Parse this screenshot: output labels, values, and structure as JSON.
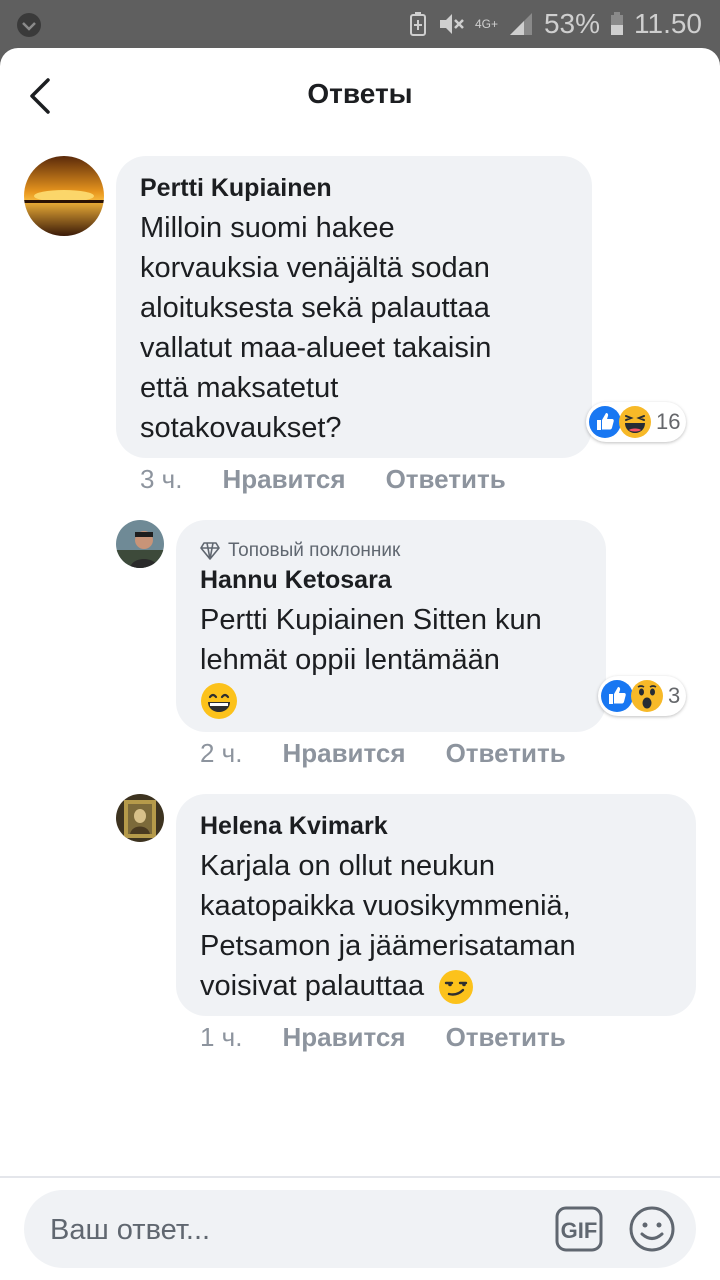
{
  "status_bar": {
    "network": "4G+",
    "battery": "53%",
    "time": "11.50"
  },
  "header": {
    "title": "Ответы"
  },
  "comments": [
    {
      "author": "Pertti Kupiainen",
      "lines": [
        "Milloin suomi hakee",
        "korvauksia venäjältä sodan",
        "aloituksesta sekä palauttaa",
        "vallatut maa-alueet takaisin",
        "että maksatetut",
        "sotakovaukset?"
      ],
      "time": "3 ч.",
      "like_label": "Нравится",
      "reply_label": "Ответить",
      "reaction_icons": [
        "like-icon",
        "haha-icon"
      ],
      "reaction_count": "16"
    },
    {
      "badge": "Топовый поклонник",
      "author": "Hannu Ketosara",
      "lines": [
        "Pertti Kupiainen Sitten kun",
        "lehmät oppii lentämään"
      ],
      "emoji": "grinning-emoji",
      "time": "2 ч.",
      "like_label": "Нравится",
      "reply_label": "Ответить",
      "reaction_icons": [
        "like-icon",
        "wow-icon"
      ],
      "reaction_count": "3"
    },
    {
      "author": "Helena Kvimark",
      "lines": [
        "Karjala on ollut neukun",
        "kaatopaikka vuosikymmeniä,",
        "Petsamon ja jäämerisataman",
        "voisivat palauttaa"
      ],
      "emoji": "smirking-emoji",
      "time": "1 ч.",
      "like_label": "Нравится",
      "reply_label": "Ответить"
    }
  ],
  "composer": {
    "placeholder": "Ваш ответ...",
    "gif_label": "GIF"
  },
  "colors": {
    "status_bar": "#5f5f5f",
    "bubble": "#f0f2f5",
    "muted_text": "#8d949e",
    "like_blue": "#1877f2",
    "haha_yellow": "#f7b928"
  }
}
